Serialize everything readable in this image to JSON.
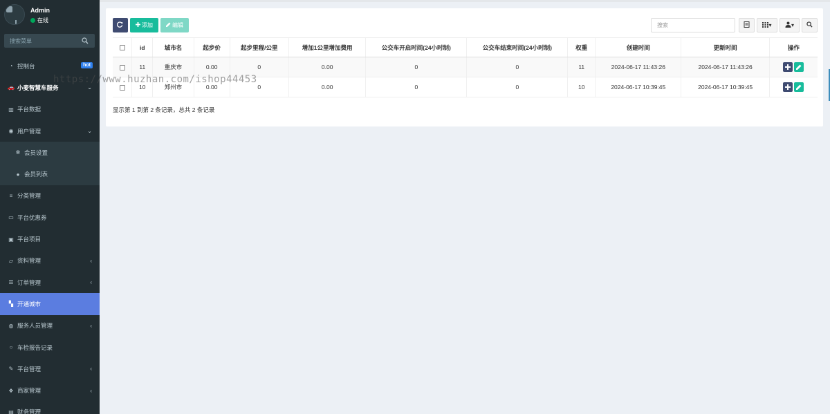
{
  "user": {
    "name": "Admin",
    "status": "在线"
  },
  "sidebar_search": {
    "placeholder": "搜索菜单"
  },
  "menu": [
    {
      "label": "控制台",
      "icon": "dashboard-icon",
      "badge": "hot"
    },
    {
      "label": "小麦智慧车服务",
      "icon": "car-icon",
      "bold": true,
      "chevron": "down"
    },
    {
      "label": "平台数据",
      "icon": "chart-icon"
    },
    {
      "label": "用户管理",
      "icon": "user-circle-icon",
      "chevron": "down"
    },
    {
      "label": "会员设置",
      "icon": "gear-icon",
      "sub": true
    },
    {
      "label": "会员列表",
      "icon": "user-icon",
      "sub": true
    },
    {
      "label": "分类管理",
      "icon": "sliders-icon"
    },
    {
      "label": "平台优惠券",
      "icon": "card-icon"
    },
    {
      "label": "平台项目",
      "icon": "bag-icon"
    },
    {
      "label": "资料管理",
      "icon": "folder-icon",
      "chevron": "left"
    },
    {
      "label": "订单管理",
      "icon": "list-icon",
      "chevron": "left"
    },
    {
      "label": "开通城市",
      "icon": "map-icon",
      "active": true
    },
    {
      "label": "服务人员管理",
      "icon": "users-icon",
      "chevron": "left"
    },
    {
      "label": "车检报告记录",
      "icon": "circle-icon"
    },
    {
      "label": "平台管理",
      "icon": "wrench-icon",
      "chevron": "left"
    },
    {
      "label": "商家管理",
      "icon": "paw-icon",
      "chevron": "left"
    },
    {
      "label": "财务管理",
      "icon": "money-icon"
    }
  ],
  "toolbar": {
    "add_label": "添加",
    "edit_label": "编辑"
  },
  "table_search": {
    "placeholder": "搜索"
  },
  "table": {
    "columns": [
      "id",
      "城市名",
      "起步价",
      "起步里程/公里",
      "增加1公里增加费用",
      "公交车开启时间(24小时制)",
      "公交车结束时间(24小时制)",
      "权重",
      "创建时间",
      "更新时间",
      "操作"
    ],
    "rows": [
      [
        "11",
        "重庆市",
        "0.00",
        "0",
        "0.00",
        "0",
        "0",
        "11",
        "2024-06-17 11:43:26",
        "2024-06-17 11:43:26"
      ],
      [
        "10",
        "郑州市",
        "0.00",
        "0",
        "0.00",
        "0",
        "0",
        "10",
        "2024-06-17 10:39:45",
        "2024-06-17 10:39:45"
      ]
    ]
  },
  "pager_text": "显示第 1 到第 2 条记录，总共 2 条记录",
  "watermark": "https://www.huzhan.com/ishop44453",
  "colors": {
    "sidebar": "#222d32",
    "active": "#5b7de0",
    "success": "#18bc9c",
    "primary": "#3f4b71"
  }
}
